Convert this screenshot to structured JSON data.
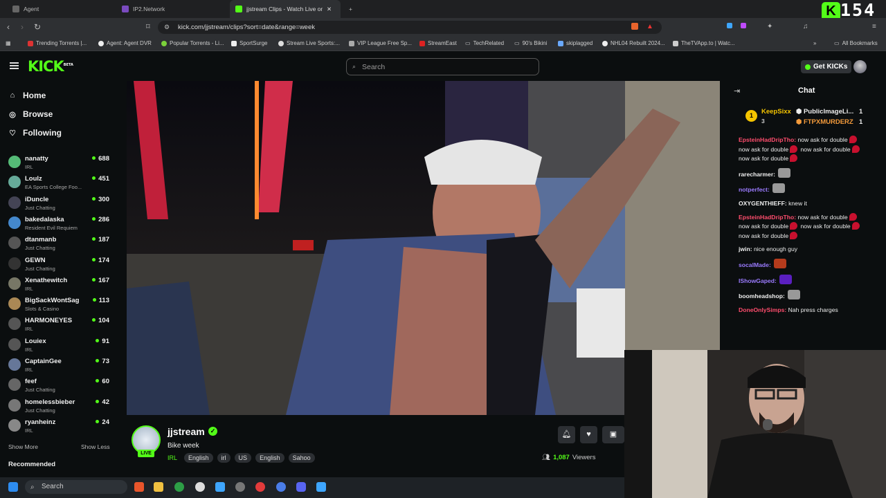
{
  "browser": {
    "tabs": [
      {
        "label": "Agent",
        "active": false
      },
      {
        "label": "IP2.Network",
        "active": false
      },
      {
        "label": "jjstream Clips - Watch Live on",
        "active": true
      }
    ],
    "url": "kick.com/jjstream/clips?sort=date&range=week",
    "bookmarks": [
      "Trending Torrents |...",
      "Agent: Agent DVR",
      "Popular Torrents - Li...",
      "SportSurge",
      "Stream Live Sports:...",
      "VIP League Free Sp...",
      "StreamEast",
      "TechRelated",
      "90's Bikini",
      "skiplagged",
      "NHL04 Rebuilt 2024...",
      "TheTVApp.to | Watc...",
      "All Bookmarks"
    ]
  },
  "overlay_counter": "154",
  "kick": {
    "logo": "KICK",
    "logo_badge": "BETA",
    "search_placeholder": "Search",
    "get_kicks": "Get KICKs",
    "nav": {
      "home": "Home",
      "browse": "Browse",
      "following": "Following"
    },
    "following": [
      {
        "name": "nanatty",
        "category": "IRL",
        "viewers": "688"
      },
      {
        "name": "Loulz",
        "category": "EA Sports College Foo...",
        "viewers": "451"
      },
      {
        "name": "iDuncle",
        "category": "Just Chatting",
        "viewers": "300"
      },
      {
        "name": "bakedalaska",
        "category": "Resident Evil Requiem",
        "viewers": "286"
      },
      {
        "name": "dtanmanb",
        "category": "Just Chatting",
        "viewers": "187"
      },
      {
        "name": "GEWN",
        "category": "Just Chatting",
        "viewers": "174"
      },
      {
        "name": "Xenathewitch",
        "category": "IRL",
        "viewers": "167"
      },
      {
        "name": "BigSackWontSag",
        "category": "Slots & Casino",
        "viewers": "113"
      },
      {
        "name": "HARMONEYES",
        "category": "IRL",
        "viewers": "104"
      },
      {
        "name": "Louiex",
        "category": "IRL",
        "viewers": "91"
      },
      {
        "name": "CaptainGee",
        "category": "IRL",
        "viewers": "73"
      },
      {
        "name": "feef",
        "category": "Just Chatting",
        "viewers": "60"
      },
      {
        "name": "homelessbieber",
        "category": "Just Chatting",
        "viewers": "42"
      },
      {
        "name": "ryanheinz",
        "category": "IRL",
        "viewers": "24"
      }
    ],
    "show_more": "Show More",
    "show_less": "Show Less",
    "recommended": "Recommended",
    "stream": {
      "channel": "jjstream",
      "title": "Bike week",
      "category": "IRL",
      "tags": [
        "English",
        "irl",
        "US",
        "English",
        "Sahoo"
      ],
      "viewers": "1,087",
      "viewers_label": "Viewers",
      "live": "LIVE"
    },
    "chat": {
      "title": "Chat",
      "gifters": [
        {
          "name": "KeepSixx",
          "count": "3"
        },
        {
          "name": "PublicImageLi...",
          "count": "1"
        },
        {
          "name": "FTPXMURDERZ",
          "count": "1"
        }
      ],
      "messages": [
        {
          "user": "EpsteinHadDripTho:",
          "color": "#ff4d6d",
          "text": "now ask for double",
          "emote": "heart",
          "repeat": 4
        },
        {
          "user": "rarecharmer:",
          "color": "#f0f0f0",
          "text": "",
          "emote": "cat"
        },
        {
          "user": "notperfect:",
          "color": "#9b7bff",
          "text": "",
          "emote": "cat"
        },
        {
          "user": "OXYGENTHIEFF:",
          "color": "#f0f0f0",
          "text": "knew it"
        },
        {
          "user": "EpsteinHadDripTho:",
          "color": "#ff4d6d",
          "text": "now ask for double",
          "emote": "heart",
          "repeat": 4
        },
        {
          "user": "jwin:",
          "color": "#f0f0f0",
          "text": "nice enough guy"
        },
        {
          "user": "socalMade:",
          "color": "#9b7bff",
          "text": "",
          "emote": "face"
        },
        {
          "user": "IShowGaped:",
          "color": "#9b7bff",
          "text": "",
          "emote": "purple"
        },
        {
          "user": "boomheadshop:",
          "color": "#f0f0f0",
          "text": "",
          "emote": "cat"
        },
        {
          "user": "DoneOnlySimps:",
          "color": "#ff4d6d",
          "text": "Nah press charges"
        }
      ]
    }
  },
  "taskbar": {
    "search": "Search"
  }
}
